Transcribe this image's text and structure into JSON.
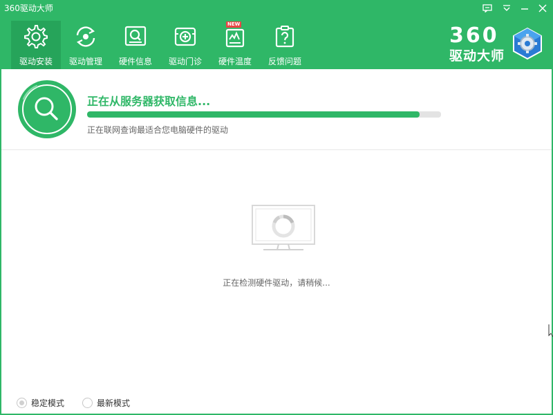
{
  "app": {
    "title": "360驱动大师",
    "accent_color": "#2fb767",
    "window_controls": [
      "feedback-icon",
      "menu-icon",
      "minimize-icon",
      "close-icon"
    ]
  },
  "nav": {
    "items": [
      {
        "label": "驱动安装",
        "icon": "gear-icon",
        "active": true
      },
      {
        "label": "驱动管理",
        "icon": "refresh-icon",
        "active": false
      },
      {
        "label": "硬件信息",
        "icon": "hardware-search-icon",
        "active": false
      },
      {
        "label": "驱动门诊",
        "icon": "clinic-plus-icon",
        "active": false
      },
      {
        "label": "硬件温度",
        "icon": "thermometer-new-icon",
        "active": false,
        "badge": "NEW"
      },
      {
        "label": "反馈问题",
        "icon": "question-clipboard-icon",
        "active": false
      }
    ]
  },
  "logo": {
    "number": "360",
    "name": "驱动大师"
  },
  "status": {
    "title": "正在从服务器获取信息...",
    "subtitle": "正在联网查询最适合您电脑硬件的驱动",
    "progress": 0.94
  },
  "detect": {
    "message": "正在检测硬件驱动，请稍候..."
  },
  "modes": {
    "stable": "稳定模式",
    "latest": "最新模式",
    "selected": "stable"
  }
}
